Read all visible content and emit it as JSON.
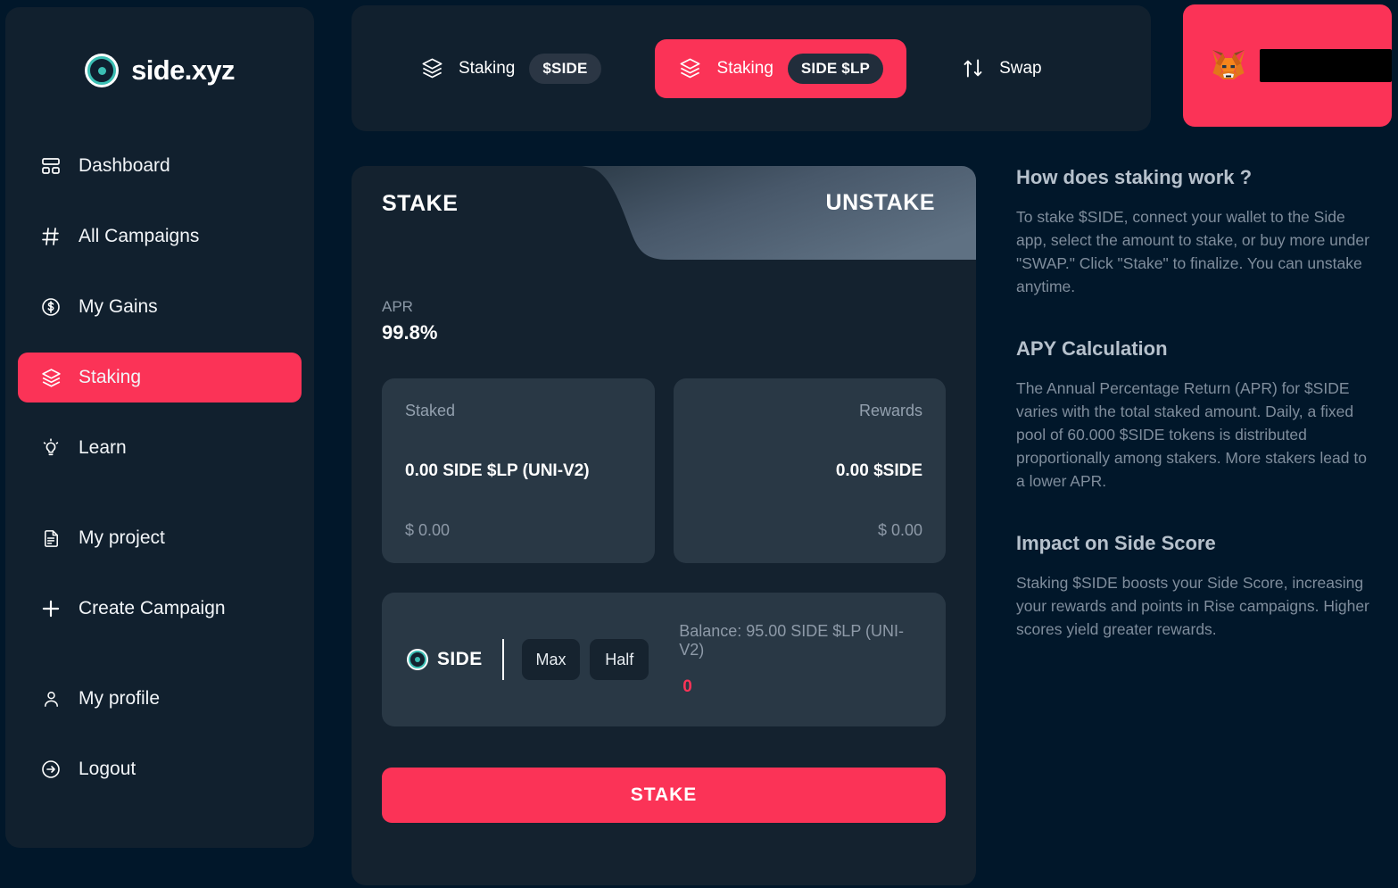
{
  "brand": {
    "name": "side.xyz",
    "logo_icon": "eye-icon"
  },
  "sidebar": {
    "items": [
      {
        "label": "Dashboard",
        "icon": "layout-dashboard-icon",
        "active": false
      },
      {
        "label": "All Campaigns",
        "icon": "hash-icon",
        "active": false
      },
      {
        "label": "My Gains",
        "icon": "dollar-circle-icon",
        "active": false
      },
      {
        "label": "Staking",
        "icon": "layers-icon",
        "active": true
      },
      {
        "label": "Learn",
        "icon": "lightbulb-icon",
        "active": false
      },
      {
        "label": "My project",
        "icon": "document-icon",
        "active": false
      },
      {
        "label": "Create Campaign",
        "icon": "plus-icon",
        "active": false
      },
      {
        "label": "My profile",
        "icon": "user-icon",
        "active": false
      },
      {
        "label": "Logout",
        "icon": "logout-arrow-icon",
        "active": false
      }
    ]
  },
  "topbar": {
    "tabs": [
      {
        "label": "Staking",
        "badge": "$SIDE",
        "icon": "layers-icon",
        "active": false
      },
      {
        "label": "Staking",
        "badge": "SIDE $LP",
        "icon": "layers-icon",
        "active": true
      },
      {
        "label": "Swap",
        "badge": "",
        "icon": "swap-arrows-icon",
        "active": false
      }
    ]
  },
  "wallet": {
    "provider_icon": "metamask-fox-icon",
    "address": "",
    "address_redacted": true
  },
  "stake_panel": {
    "tab_stake": "STAKE",
    "tab_unstake": "UNSTAKE",
    "active_tab": "STAKE",
    "apr_label": "APR",
    "apr_value": "99.8%",
    "staked": {
      "title": "Staked",
      "amount": "0.00 SIDE $LP (UNI-V2)",
      "usd": "$ 0.00"
    },
    "rewards": {
      "title": "Rewards",
      "amount": "0.00 $SIDE",
      "usd": "$ 0.00"
    },
    "input": {
      "token_symbol": "SIDE",
      "token_icon": "eye-icon",
      "max_label": "Max",
      "half_label": "Half",
      "balance_text": "Balance: 95.00 SIDE $LP (UNI-V2)",
      "amount_value": "0",
      "amount_placeholder": "0"
    },
    "submit_label": "STAKE"
  },
  "info_panel": {
    "blocks": [
      {
        "heading": "How does staking work ?",
        "body": "To stake $SIDE, connect your wallet to the Side app, select the amount to stake, or buy more under \"SWAP.\" Click \"Stake\" to finalize. You can unstake anytime."
      },
      {
        "heading": "APY Calculation",
        "body": "The Annual Percentage Return (APR) for $SIDE varies with the total staked amount. Daily, a fixed pool of 60.000 $SIDE tokens is distributed proportionally among stakers. More stakers lead to a lower APR."
      },
      {
        "heading": "Impact on Side Score",
        "body": "Staking $SIDE boosts your Side Score, increasing your rewards and points in Rise campaigns. Higher scores yield greater rewards."
      }
    ]
  },
  "colors": {
    "accent_pink": "#fb3357",
    "page_bg": "#01172a",
    "panel_bg": "#11202e",
    "card_bg": "#14222f",
    "inner_card_bg": "#293845",
    "logo_teal": "#3bbfb4"
  }
}
